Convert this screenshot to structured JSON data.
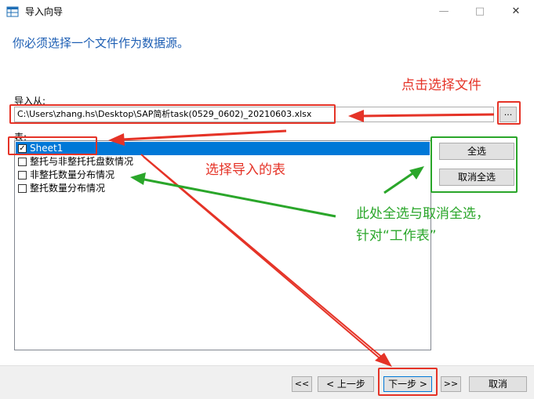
{
  "window": {
    "title": "导入向导",
    "minimize_glyph": "—",
    "maximize_glyph": "□",
    "close_glyph": "✕"
  },
  "heading": "你必须选择一个文件作为数据源。",
  "import_from": {
    "label": "导入从:",
    "path": "C:\\Users\\zhang.hs\\Desktop\\SAP简析task(0529_0602)_20210603.xlsx",
    "browse_label": "..."
  },
  "tables": {
    "label": "表:",
    "items": [
      {
        "label": "Sheet1",
        "checked": true,
        "check_glyph": "✓"
      },
      {
        "label": "整托与非整托托盘数情况",
        "checked": false,
        "check_glyph": ""
      },
      {
        "label": "非整托数量分布情况",
        "checked": false,
        "check_glyph": ""
      },
      {
        "label": "整托数量分布情况",
        "checked": false,
        "check_glyph": ""
      }
    ]
  },
  "buttons": {
    "select_all": "全选",
    "deselect_all": "取消全选"
  },
  "footer": {
    "first": "<<",
    "prev": "< 上一步",
    "next": "下一步 >",
    "last": ">>",
    "cancel": "取消"
  },
  "annotations": {
    "click_select_file": "点击选择文件",
    "select_table": "选择导入的表",
    "select_all_note_line1": "此处全选与取消全选，",
    "select_all_note_line2": "针对“工作表”"
  },
  "colors": {
    "annotation_red": "#e53327",
    "annotation_green": "#2aa62a",
    "selection_blue": "#0078d7",
    "heading_blue": "#1e5fb4"
  }
}
